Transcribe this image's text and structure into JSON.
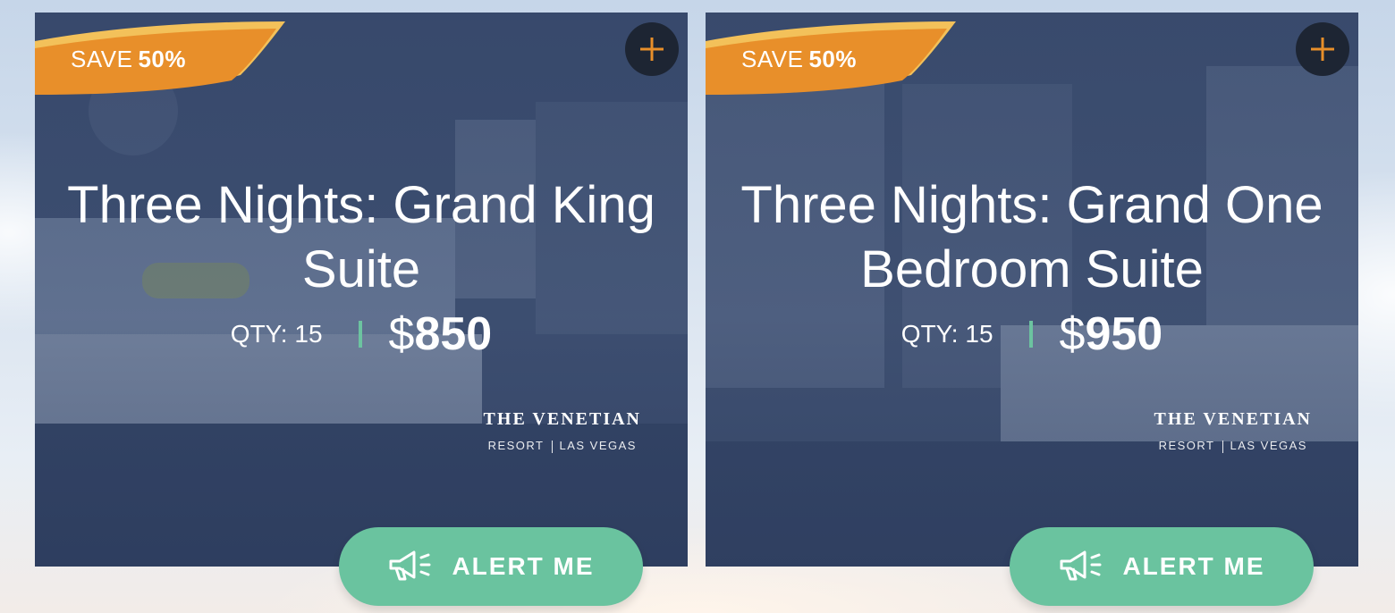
{
  "colors": {
    "ribbon_orange": "#e88f2a",
    "ribbon_yellow": "#f3c15a",
    "alert_green": "#6ac39f",
    "separator_teal": "#6cc3a0",
    "plus_button_bg": "#1d2533",
    "card_overlay": "#2c3e62"
  },
  "cards": [
    {
      "save_prefix": "SAVE",
      "save_percent": "50%",
      "title": "Three Nights: Grand King Suite",
      "qty": "QTY: 15",
      "currency": "$",
      "price": "850",
      "logo_name": "THE VENETIAN",
      "logo_sub_left": "RESORT",
      "logo_sub_right": "LAS VEGAS",
      "alert_label": "ALERT ME",
      "plus_icon": "plus-icon",
      "alert_icon": "megaphone-icon"
    },
    {
      "save_prefix": "SAVE",
      "save_percent": "50%",
      "title": "Three Nights: Grand One Bedroom Suite",
      "qty": "QTY: 15",
      "currency": "$",
      "price": "950",
      "logo_name": "THE VENETIAN",
      "logo_sub_left": "RESORT",
      "logo_sub_right": "LAS VEGAS",
      "alert_label": "ALERT ME",
      "plus_icon": "plus-icon",
      "alert_icon": "megaphone-icon"
    }
  ]
}
